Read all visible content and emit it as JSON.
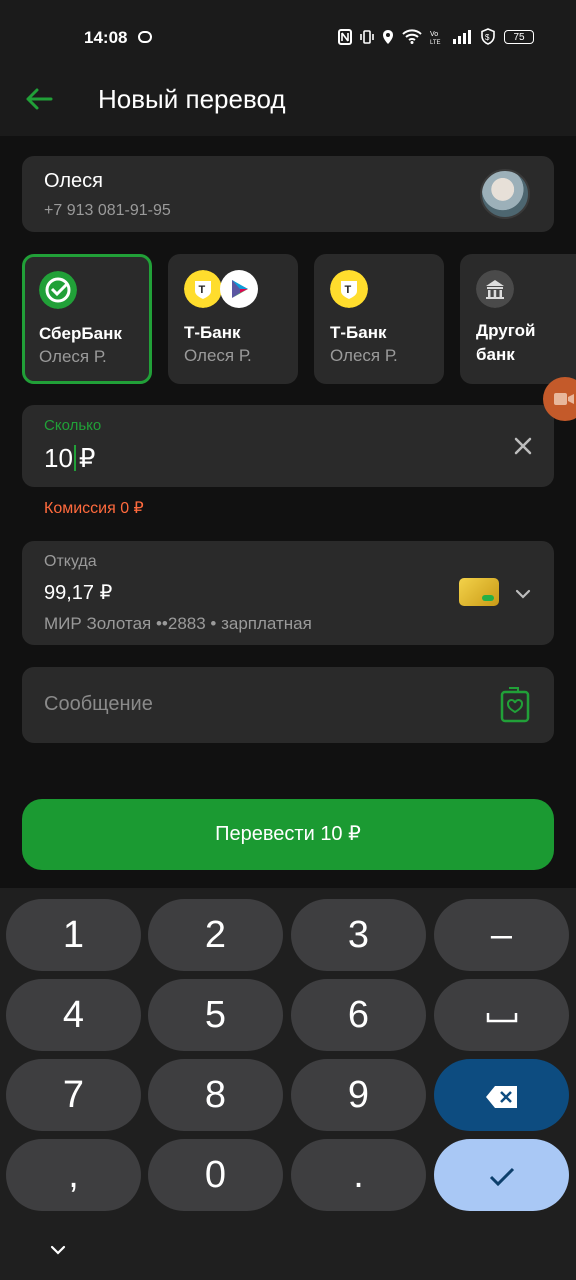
{
  "status_bar": {
    "time": "14:08",
    "battery": "75"
  },
  "header": {
    "title": "Новый перевод"
  },
  "recipient": {
    "name": "Олеся",
    "phone": "+7 913 081-91-95"
  },
  "banks": [
    {
      "name": "СберБанк",
      "holder": "Олеся Р.",
      "selected": true
    },
    {
      "name": "Т-Банк",
      "holder": "Олеся Р."
    },
    {
      "name": "Т-Банк",
      "holder": "Олеся Р."
    },
    {
      "name": "Другой",
      "name2": "банк"
    }
  ],
  "amount": {
    "label": "Сколько",
    "value": "10",
    "currency": "₽"
  },
  "commission": "Комиссия 0 ₽",
  "from": {
    "label": "Откуда",
    "balance": "99,17 ₽",
    "card": "МИР Золотая ••2883  • зарплатная"
  },
  "message": {
    "placeholder": "Сообщение"
  },
  "transfer_button": "Перевести 10 ₽",
  "keyboard": {
    "k1": "1",
    "k2": "2",
    "k3": "3",
    "minus": "–",
    "k4": "4",
    "k5": "5",
    "k6": "6",
    "space": "␣",
    "k7": "7",
    "k8": "8",
    "k9": "9",
    "comma": ",",
    "k0": "0",
    "dot": "."
  },
  "colors": {
    "accent": "#21a038",
    "button": "#1b9a32",
    "commission": "#ff6a3d",
    "backspace_key": "#0d4c80",
    "done_key": "#a9c8f5"
  }
}
